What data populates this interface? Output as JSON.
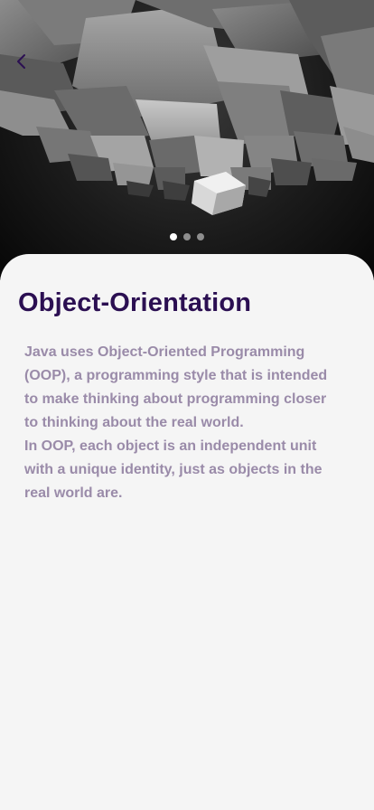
{
  "hero": {
    "image_description": "abstract grey geometric cubes",
    "back_icon": "chevron-left-icon",
    "back_icon_color": "#2b0f52",
    "pager": {
      "total": 3,
      "active_index": 0
    }
  },
  "content": {
    "title": "Object-Orientation",
    "paragraph_1": "Java uses Object-Oriented Programming (OOP), a programming style that is intended to make thinking about programming closer to thinking about the real world.",
    "paragraph_2": "In OOP, each object is an independent unit with a unique identity, just as objects in the real world are."
  },
  "colors": {
    "title": "#2b0f52",
    "body": "#9a8ba9",
    "background": "#f5f5f5"
  }
}
